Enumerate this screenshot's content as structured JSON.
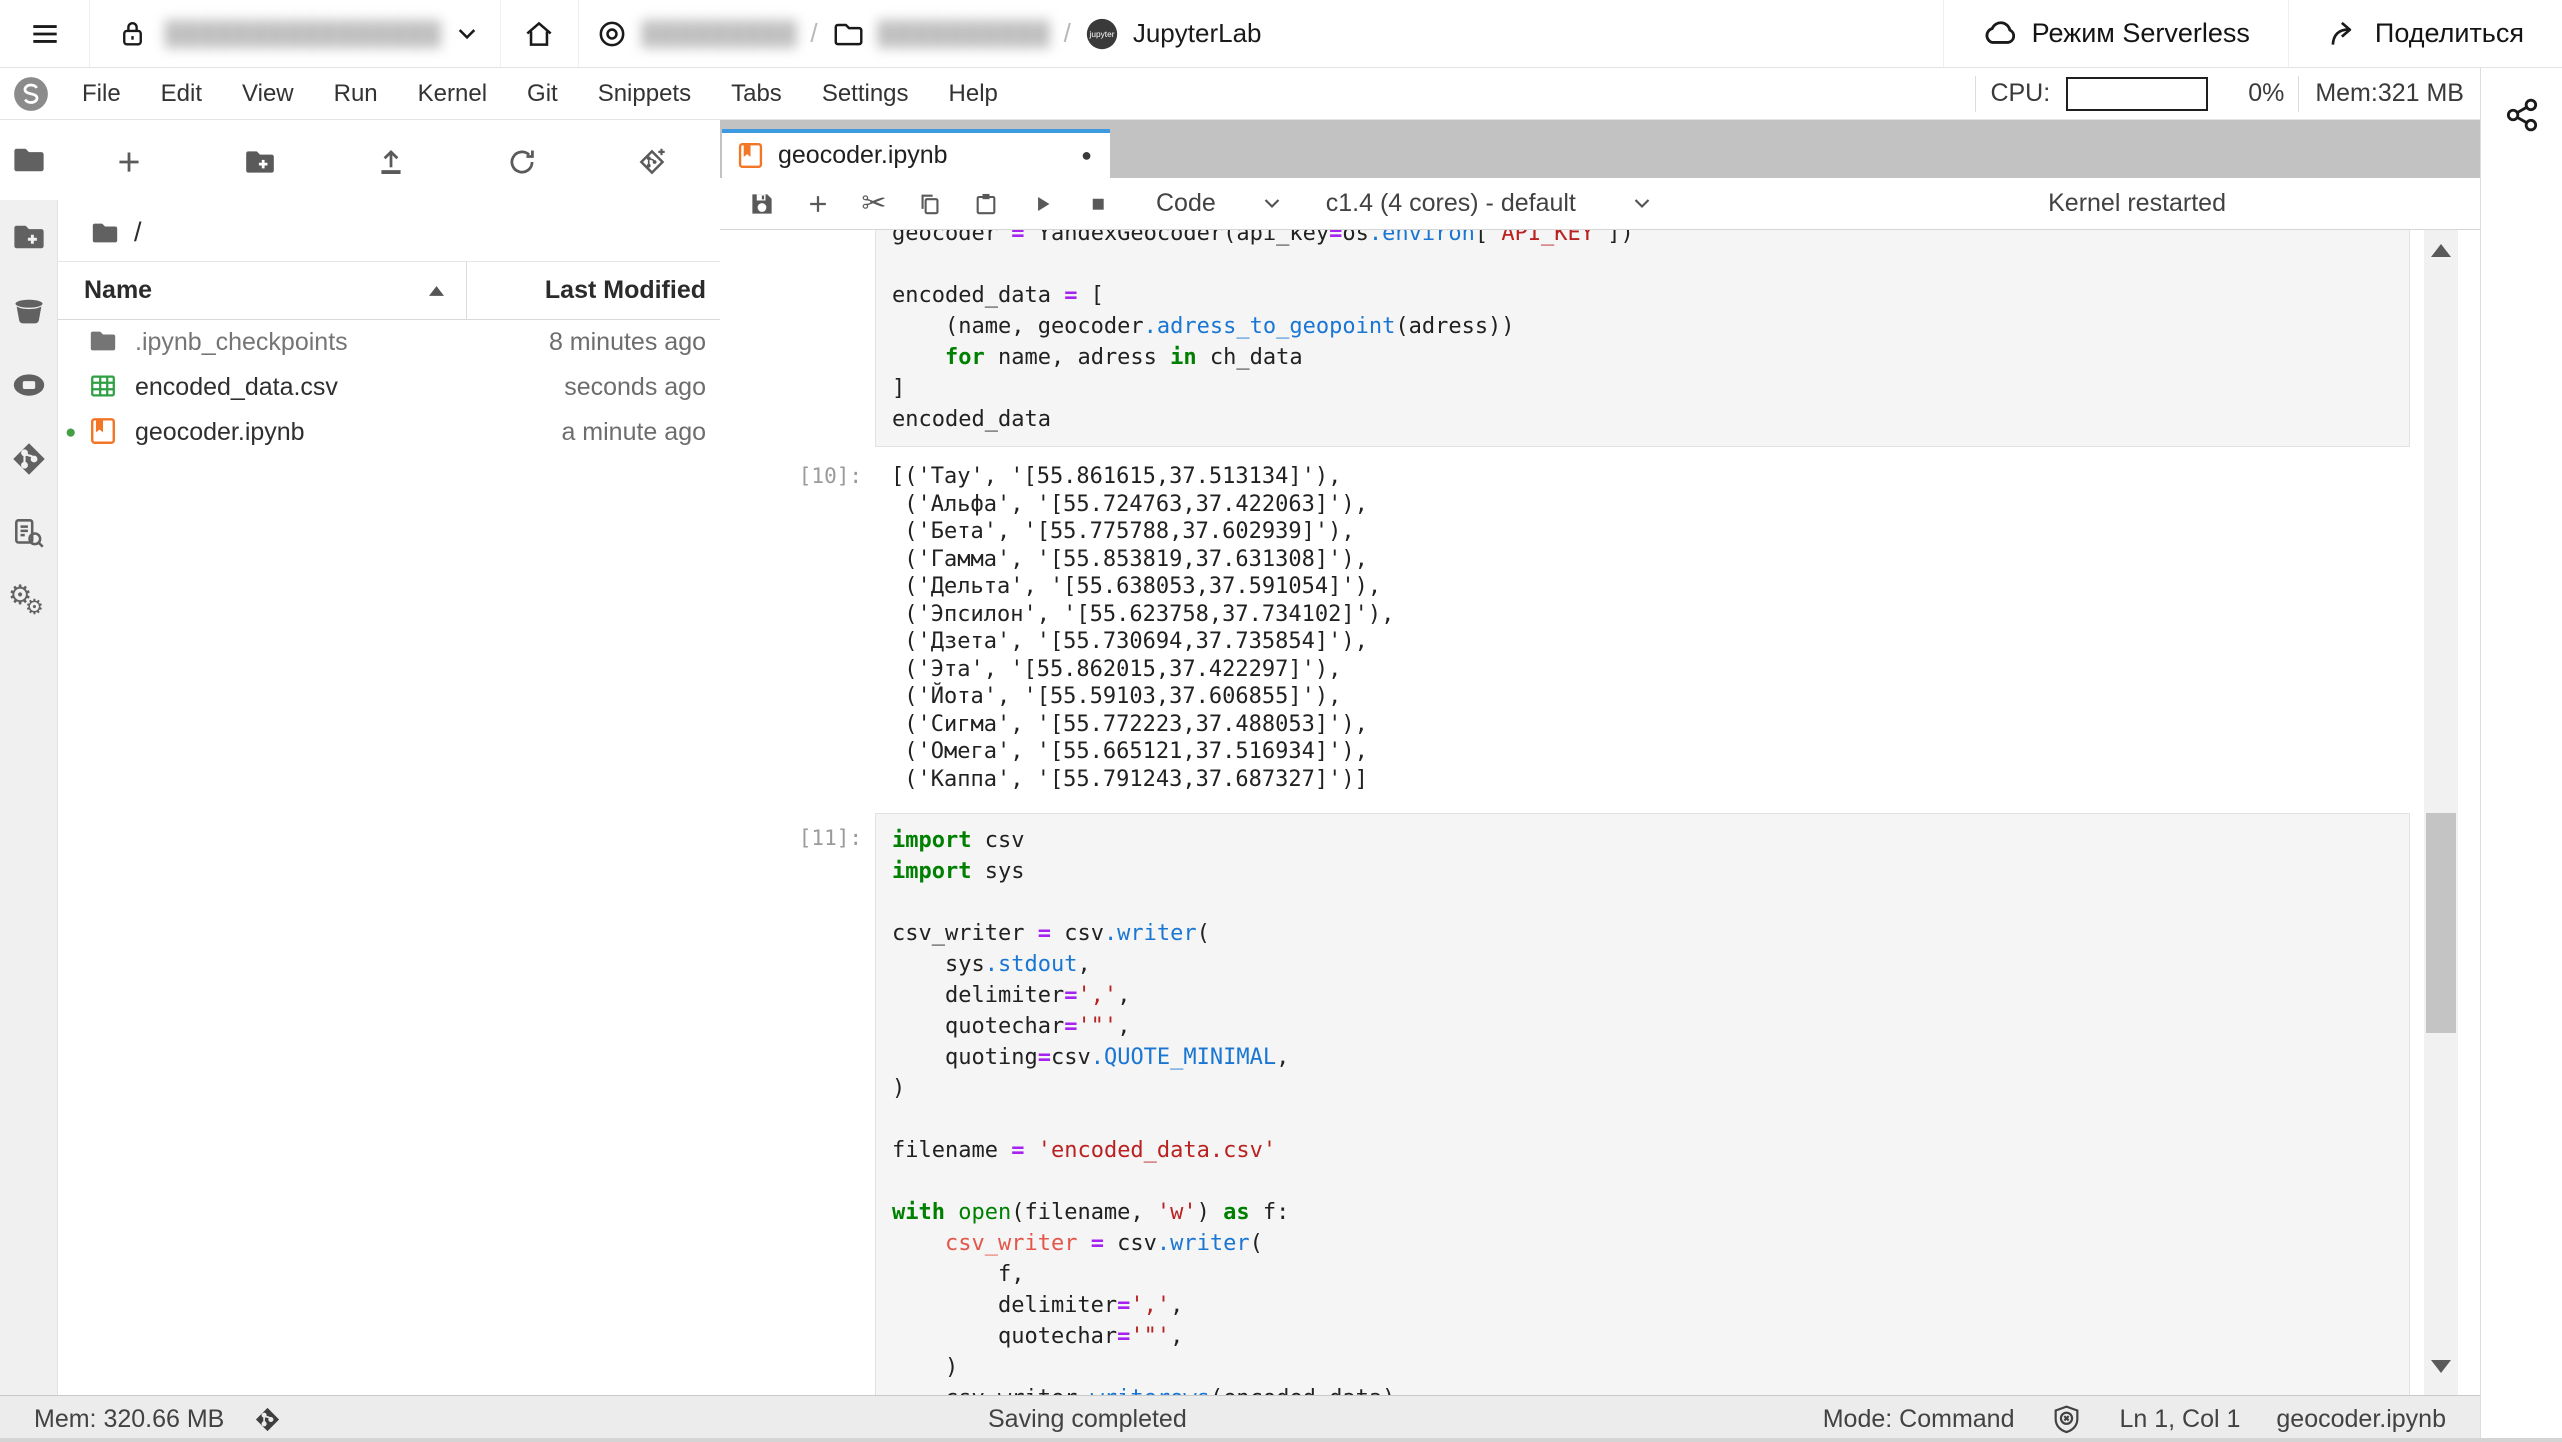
{
  "topbar": {
    "redacted_workspace": "████████████████",
    "redacted_project": "█████████",
    "redacted_folder": "██████████",
    "separator": "/",
    "jupyterlab": "JupyterLab",
    "serverless": "Режим Serverless",
    "share": "Поделиться"
  },
  "menubar": {
    "items": [
      "File",
      "Edit",
      "View",
      "Run",
      "Kernel",
      "Git",
      "Snippets",
      "Tabs",
      "Settings",
      "Help"
    ],
    "cpu_label": "CPU:",
    "cpu_value": "0%",
    "mem_value": "Mem:321 MB"
  },
  "filebrowser": {
    "path": "/",
    "name_header": "Name",
    "modified_header": "Last Modified",
    "files": [
      {
        "name": ".ipynb_checkpoints",
        "modified": "8 minutes ago",
        "icon": "folder",
        "muted": true,
        "dirty": false
      },
      {
        "name": "encoded_data.csv",
        "modified": "seconds ago",
        "icon": "csv",
        "muted": false,
        "dirty": false
      },
      {
        "name": "geocoder.ipynb",
        "modified": "a minute ago",
        "icon": "notebook",
        "muted": false,
        "dirty": true
      }
    ]
  },
  "dock": {
    "tab_title": "geocoder.ipynb",
    "cell_type": "Code",
    "kernel_name": "c1.4 (4 cores) - default",
    "kernel_status": "Kernel restarted"
  },
  "notebook": {
    "cells": [
      {
        "type": "code",
        "prompt": "",
        "clip": "top",
        "lines": [
          [
            {
              "c": "n",
              "t": "geocoder "
            },
            {
              "c": "o",
              "t": "="
            },
            {
              "c": "n",
              "t": " YandexGeocoder(api_key"
            },
            {
              "c": "o",
              "t": "="
            },
            {
              "c": "n",
              "t": "os"
            },
            {
              "c": "p",
              "t": ".environ"
            },
            {
              "c": "n",
              "t": "["
            },
            {
              "c": "s",
              "t": "'API_KEY'"
            },
            {
              "c": "n",
              "t": "])"
            }
          ],
          [],
          [
            {
              "c": "n",
              "t": "encoded_data "
            },
            {
              "c": "o",
              "t": "="
            },
            {
              "c": "n",
              "t": " ["
            }
          ],
          [
            {
              "c": "n",
              "t": "    (name, geocoder"
            },
            {
              "c": "p",
              "t": ".adress_to_geopoint"
            },
            {
              "c": "n",
              "t": "(adress))"
            }
          ],
          [
            {
              "c": "n",
              "t": "    "
            },
            {
              "c": "k",
              "t": "for"
            },
            {
              "c": "n",
              "t": " name, adress "
            },
            {
              "c": "k",
              "t": "in"
            },
            {
              "c": "n",
              "t": " ch_data"
            }
          ],
          [
            {
              "c": "n",
              "t": "]"
            }
          ],
          [
            {
              "c": "n",
              "t": "encoded_data"
            }
          ]
        ]
      },
      {
        "type": "output",
        "prompt": "[10]:",
        "lines": [
          "[('Тау', '[55.861615,37.513134]'),",
          " ('Альфа', '[55.724763,37.422063]'),",
          " ('Бета', '[55.775788,37.602939]'),",
          " ('Гамма', '[55.853819,37.631308]'),",
          " ('Дельта', '[55.638053,37.591054]'),",
          " ('Эпсилон', '[55.623758,37.734102]'),",
          " ('Дзета', '[55.730694,37.735854]'),",
          " ('Эта', '[55.862015,37.422297]'),",
          " ('Йота', '[55.59103,37.606855]'),",
          " ('Сигма', '[55.772223,37.488053]'),",
          " ('Омега', '[55.665121,37.516934]'),",
          " ('Каппа', '[55.791243,37.687327]')]"
        ]
      },
      {
        "type": "code",
        "prompt": "[11]:",
        "clip": "",
        "lines": [
          [
            {
              "c": "k",
              "t": "import"
            },
            {
              "c": "n",
              "t": " csv"
            }
          ],
          [
            {
              "c": "k",
              "t": "import"
            },
            {
              "c": "n",
              "t": " sys"
            }
          ],
          [],
          [
            {
              "c": "n",
              "t": "csv_writer "
            },
            {
              "c": "o",
              "t": "="
            },
            {
              "c": "n",
              "t": " csv"
            },
            {
              "c": "p",
              "t": ".writer"
            },
            {
              "c": "n",
              "t": "("
            }
          ],
          [
            {
              "c": "n",
              "t": "    sys"
            },
            {
              "c": "p",
              "t": ".stdout"
            },
            {
              "c": "n",
              "t": ","
            }
          ],
          [
            {
              "c": "n",
              "t": "    delimiter"
            },
            {
              "c": "o",
              "t": "="
            },
            {
              "c": "s",
              "t": "','"
            },
            {
              "c": "n",
              "t": ","
            }
          ],
          [
            {
              "c": "n",
              "t": "    quotechar"
            },
            {
              "c": "o",
              "t": "="
            },
            {
              "c": "s",
              "t": "'\"'"
            },
            {
              "c": "n",
              "t": ","
            }
          ],
          [
            {
              "c": "n",
              "t": "    quoting"
            },
            {
              "c": "o",
              "t": "="
            },
            {
              "c": "n",
              "t": "csv"
            },
            {
              "c": "p",
              "t": ".QUOTE_MINIMAL"
            },
            {
              "c": "n",
              "t": ","
            }
          ],
          [
            {
              "c": "n",
              "t": ")"
            }
          ],
          [],
          [
            {
              "c": "n",
              "t": "filename "
            },
            {
              "c": "o",
              "t": "="
            },
            {
              "c": "n",
              "t": " "
            },
            {
              "c": "s",
              "t": "'encoded_data.csv'"
            }
          ],
          [],
          [
            {
              "c": "k",
              "t": "with"
            },
            {
              "c": "n",
              "t": " "
            },
            {
              "c": "b",
              "t": "open"
            },
            {
              "c": "n",
              "t": "(filename, "
            },
            {
              "c": "s",
              "t": "'w'"
            },
            {
              "c": "n",
              "t": ") "
            },
            {
              "c": "k",
              "t": "as"
            },
            {
              "c": "n",
              "t": " f:"
            }
          ],
          [
            {
              "c": "n",
              "t": "    "
            },
            {
              "c": "v",
              "t": "csv_writer"
            },
            {
              "c": "n",
              "t": " "
            },
            {
              "c": "o",
              "t": "="
            },
            {
              "c": "n",
              "t": " csv"
            },
            {
              "c": "p",
              "t": ".writer"
            },
            {
              "c": "n",
              "t": "("
            }
          ],
          [
            {
              "c": "n",
              "t": "        f,"
            }
          ],
          [
            {
              "c": "n",
              "t": "        delimiter"
            },
            {
              "c": "o",
              "t": "="
            },
            {
              "c": "s",
              "t": "','"
            },
            {
              "c": "n",
              "t": ","
            }
          ],
          [
            {
              "c": "n",
              "t": "        quotechar"
            },
            {
              "c": "o",
              "t": "="
            },
            {
              "c": "s",
              "t": "'\"'"
            },
            {
              "c": "n",
              "t": ","
            }
          ],
          [
            {
              "c": "n",
              "t": "    )"
            }
          ],
          [
            {
              "c": "n",
              "t": "    csv_writer"
            },
            {
              "c": "p",
              "t": ".writerows"
            },
            {
              "c": "n",
              "t": "(encoded_data)"
            }
          ]
        ]
      }
    ]
  },
  "statusbar": {
    "mem": "Mem: 320.66 MB",
    "save_status": "Saving completed",
    "mode": "Mode: Command",
    "cursor": "Ln 1, Col 1",
    "file": "geocoder.ipynb"
  },
  "colors": {
    "accent_blue": "#3d9ae0",
    "jupyter_orange": "#f37626",
    "csv_green": "#2ea043",
    "unsaved_green": "#43a047"
  }
}
